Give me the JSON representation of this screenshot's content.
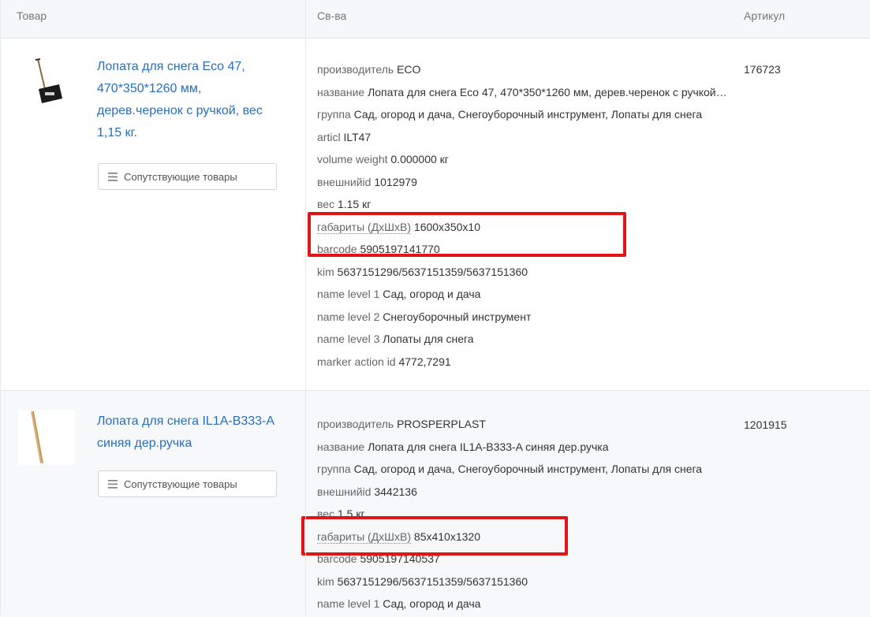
{
  "header": {
    "col_product": "Товар",
    "col_props": "Св-ва",
    "col_sku": "Артикул"
  },
  "rows": [
    {
      "title": "Лопата для снега Eco 47, 470*350*1260 мм, дерев.черенок с ручкой, вес 1,15 кг.",
      "related_label": "Сопутствующие товары",
      "sku": "176723",
      "props": [
        {
          "k": "производитель",
          "v": "ECO"
        },
        {
          "k": "название",
          "v": "Лопата для снега Eco 47, 470*350*1260 мм, дерев.черенок с ручкой, вес 1,15 кг."
        },
        {
          "k": "группа",
          "v": "Сад, огород и дача, Снегоуборочный инструмент, Лопаты для снега"
        },
        {
          "k": "articl",
          "v": "ILT47"
        },
        {
          "k": "volume weight",
          "v": "0.000000 кг"
        },
        {
          "k": "внешнийid",
          "v": "1012979"
        },
        {
          "k": "вес",
          "v": "1.15 кг"
        },
        {
          "k": "габариты (ДхШхВ)",
          "v": "1600x350x10"
        },
        {
          "k": "barcode",
          "v": "5905197141770"
        },
        {
          "k": "kim",
          "v": "5637151296/5637151359/5637151360"
        },
        {
          "k": "name level 1",
          "v": "Сад, огород и дача"
        },
        {
          "k": "name level 2",
          "v": "Снегоуборочный инструмент"
        },
        {
          "k": "name level 3",
          "v": "Лопаты для снега"
        },
        {
          "k": "marker action id",
          "v": "4772,7291"
        }
      ]
    },
    {
      "title": "Лопата для снега IL1A-B333-A синяя дер.ручка",
      "related_label": "Сопутствующие товары",
      "sku": "1201915",
      "props": [
        {
          "k": "производитель",
          "v": "PROSPERPLAST"
        },
        {
          "k": "название",
          "v": "Лопата для снега IL1A-B333-A синяя дер.ручка"
        },
        {
          "k": "группа",
          "v": "Сад, огород и дача, Снегоуборочный инструмент, Лопаты для снега"
        },
        {
          "k": "внешнийid",
          "v": "3442136"
        },
        {
          "k": "вес",
          "v": "1.5 кг"
        },
        {
          "k": "габариты (ДхШхВ)",
          "v": "85x410x1320"
        },
        {
          "k": "barcode",
          "v": "5905197140537"
        },
        {
          "k": "kim",
          "v": "5637151296/5637151359/5637151360"
        },
        {
          "k": "name level 1",
          "v": "Сад, огород и дача"
        }
      ]
    }
  ],
  "colors": {
    "link": "#2a6ebb",
    "highlight": "#e1141a"
  }
}
